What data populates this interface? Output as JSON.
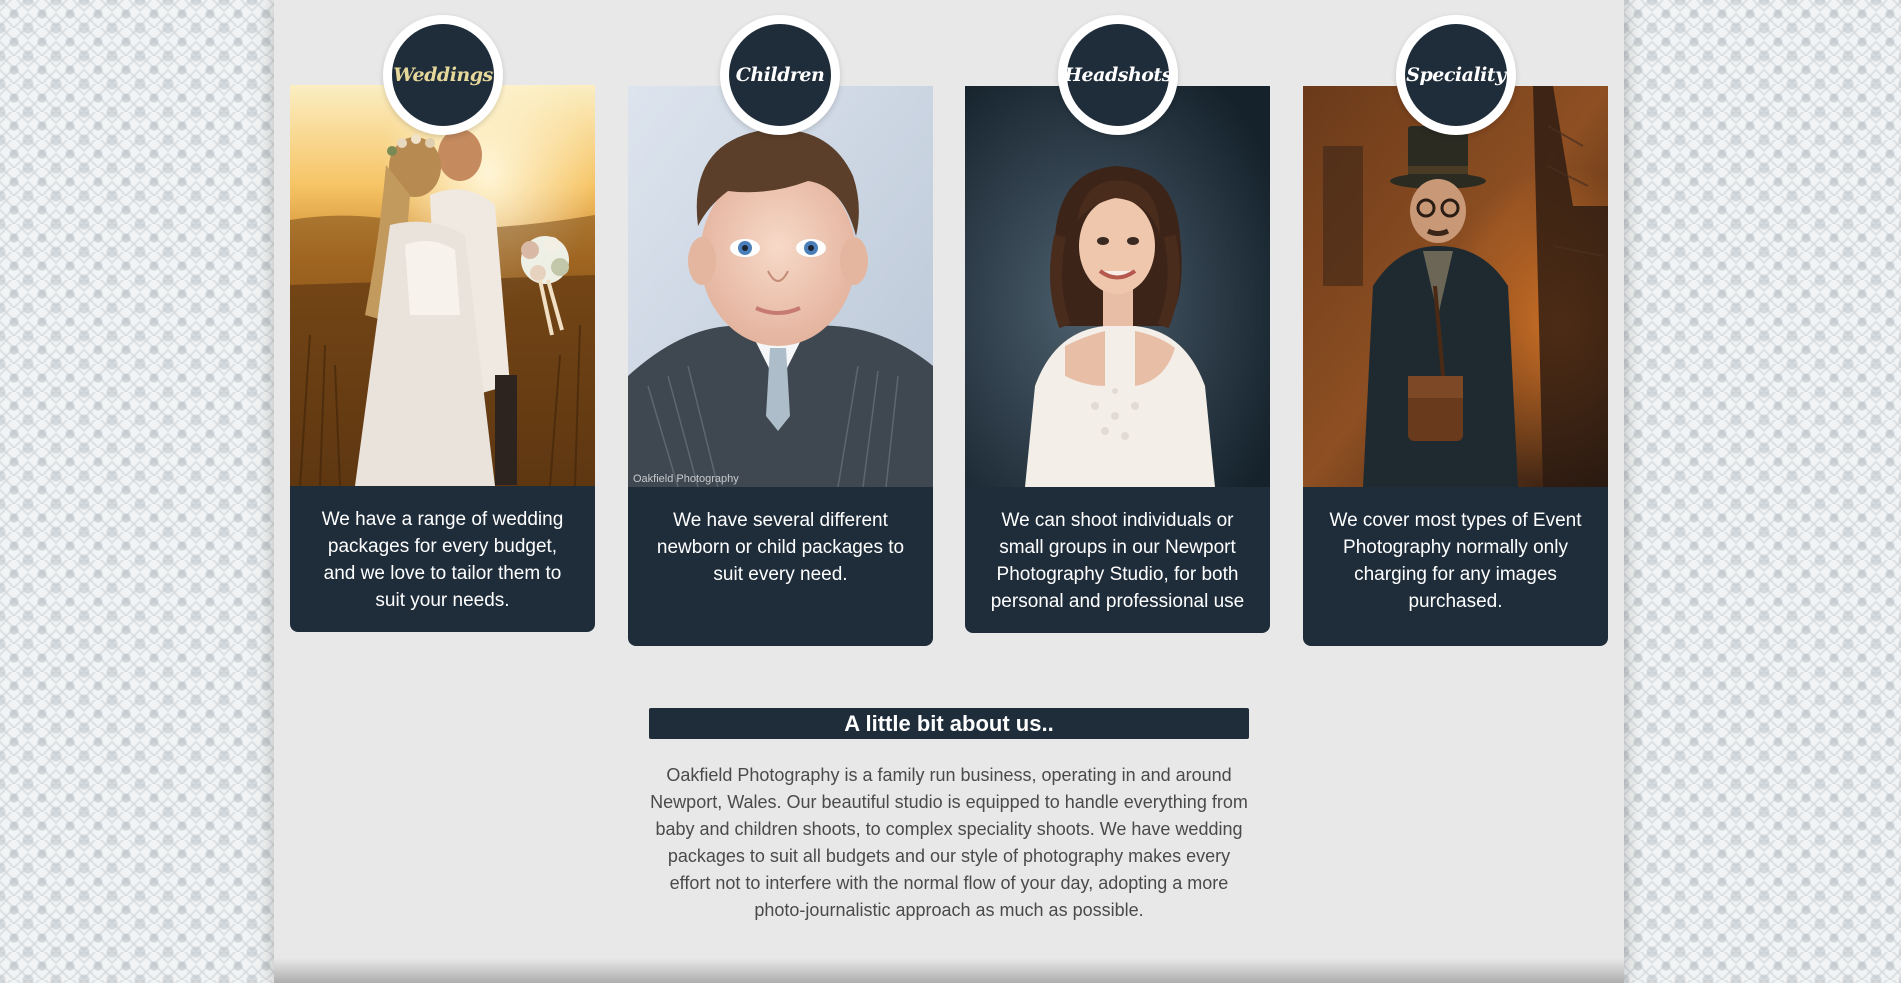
{
  "services": [
    {
      "badge": "Weddings",
      "photo": "wedding-couple-photo",
      "description": "We have a range of wedding packages for every budget, and we love to tailor them to suit your needs."
    },
    {
      "badge": "Children",
      "photo": "child-portrait-photo",
      "watermark": "Oakfield Photography",
      "description": "We have several different newborn or child packages to suit every need."
    },
    {
      "badge": "Headshots",
      "photo": "woman-headshot-photo",
      "description": "We can shoot individuals or small groups in our Newport Photography Studio, for both personal and professional use"
    },
    {
      "badge": "Speciality",
      "photo": "steampunk-man-photo",
      "description": "We cover most types of Event Photography normally only charging for any images purchased."
    }
  ],
  "about": {
    "heading": "A little bit about us..",
    "body": "Oakfield Photography is a family run business, operating in and around Newport, Wales. Our beautiful studio is equipped to handle everything from baby and children shoots, to complex speciality shoots. We have wedding packages to suit all budgets and our style of photography makes every effort not to interfere with the normal flow of your day, adopting a more photo-journalistic approach as much as possible."
  },
  "colors": {
    "navy": "#1f2d3b",
    "badge_highlight": "#e6d89a",
    "page_background": "#e8e8e8"
  }
}
